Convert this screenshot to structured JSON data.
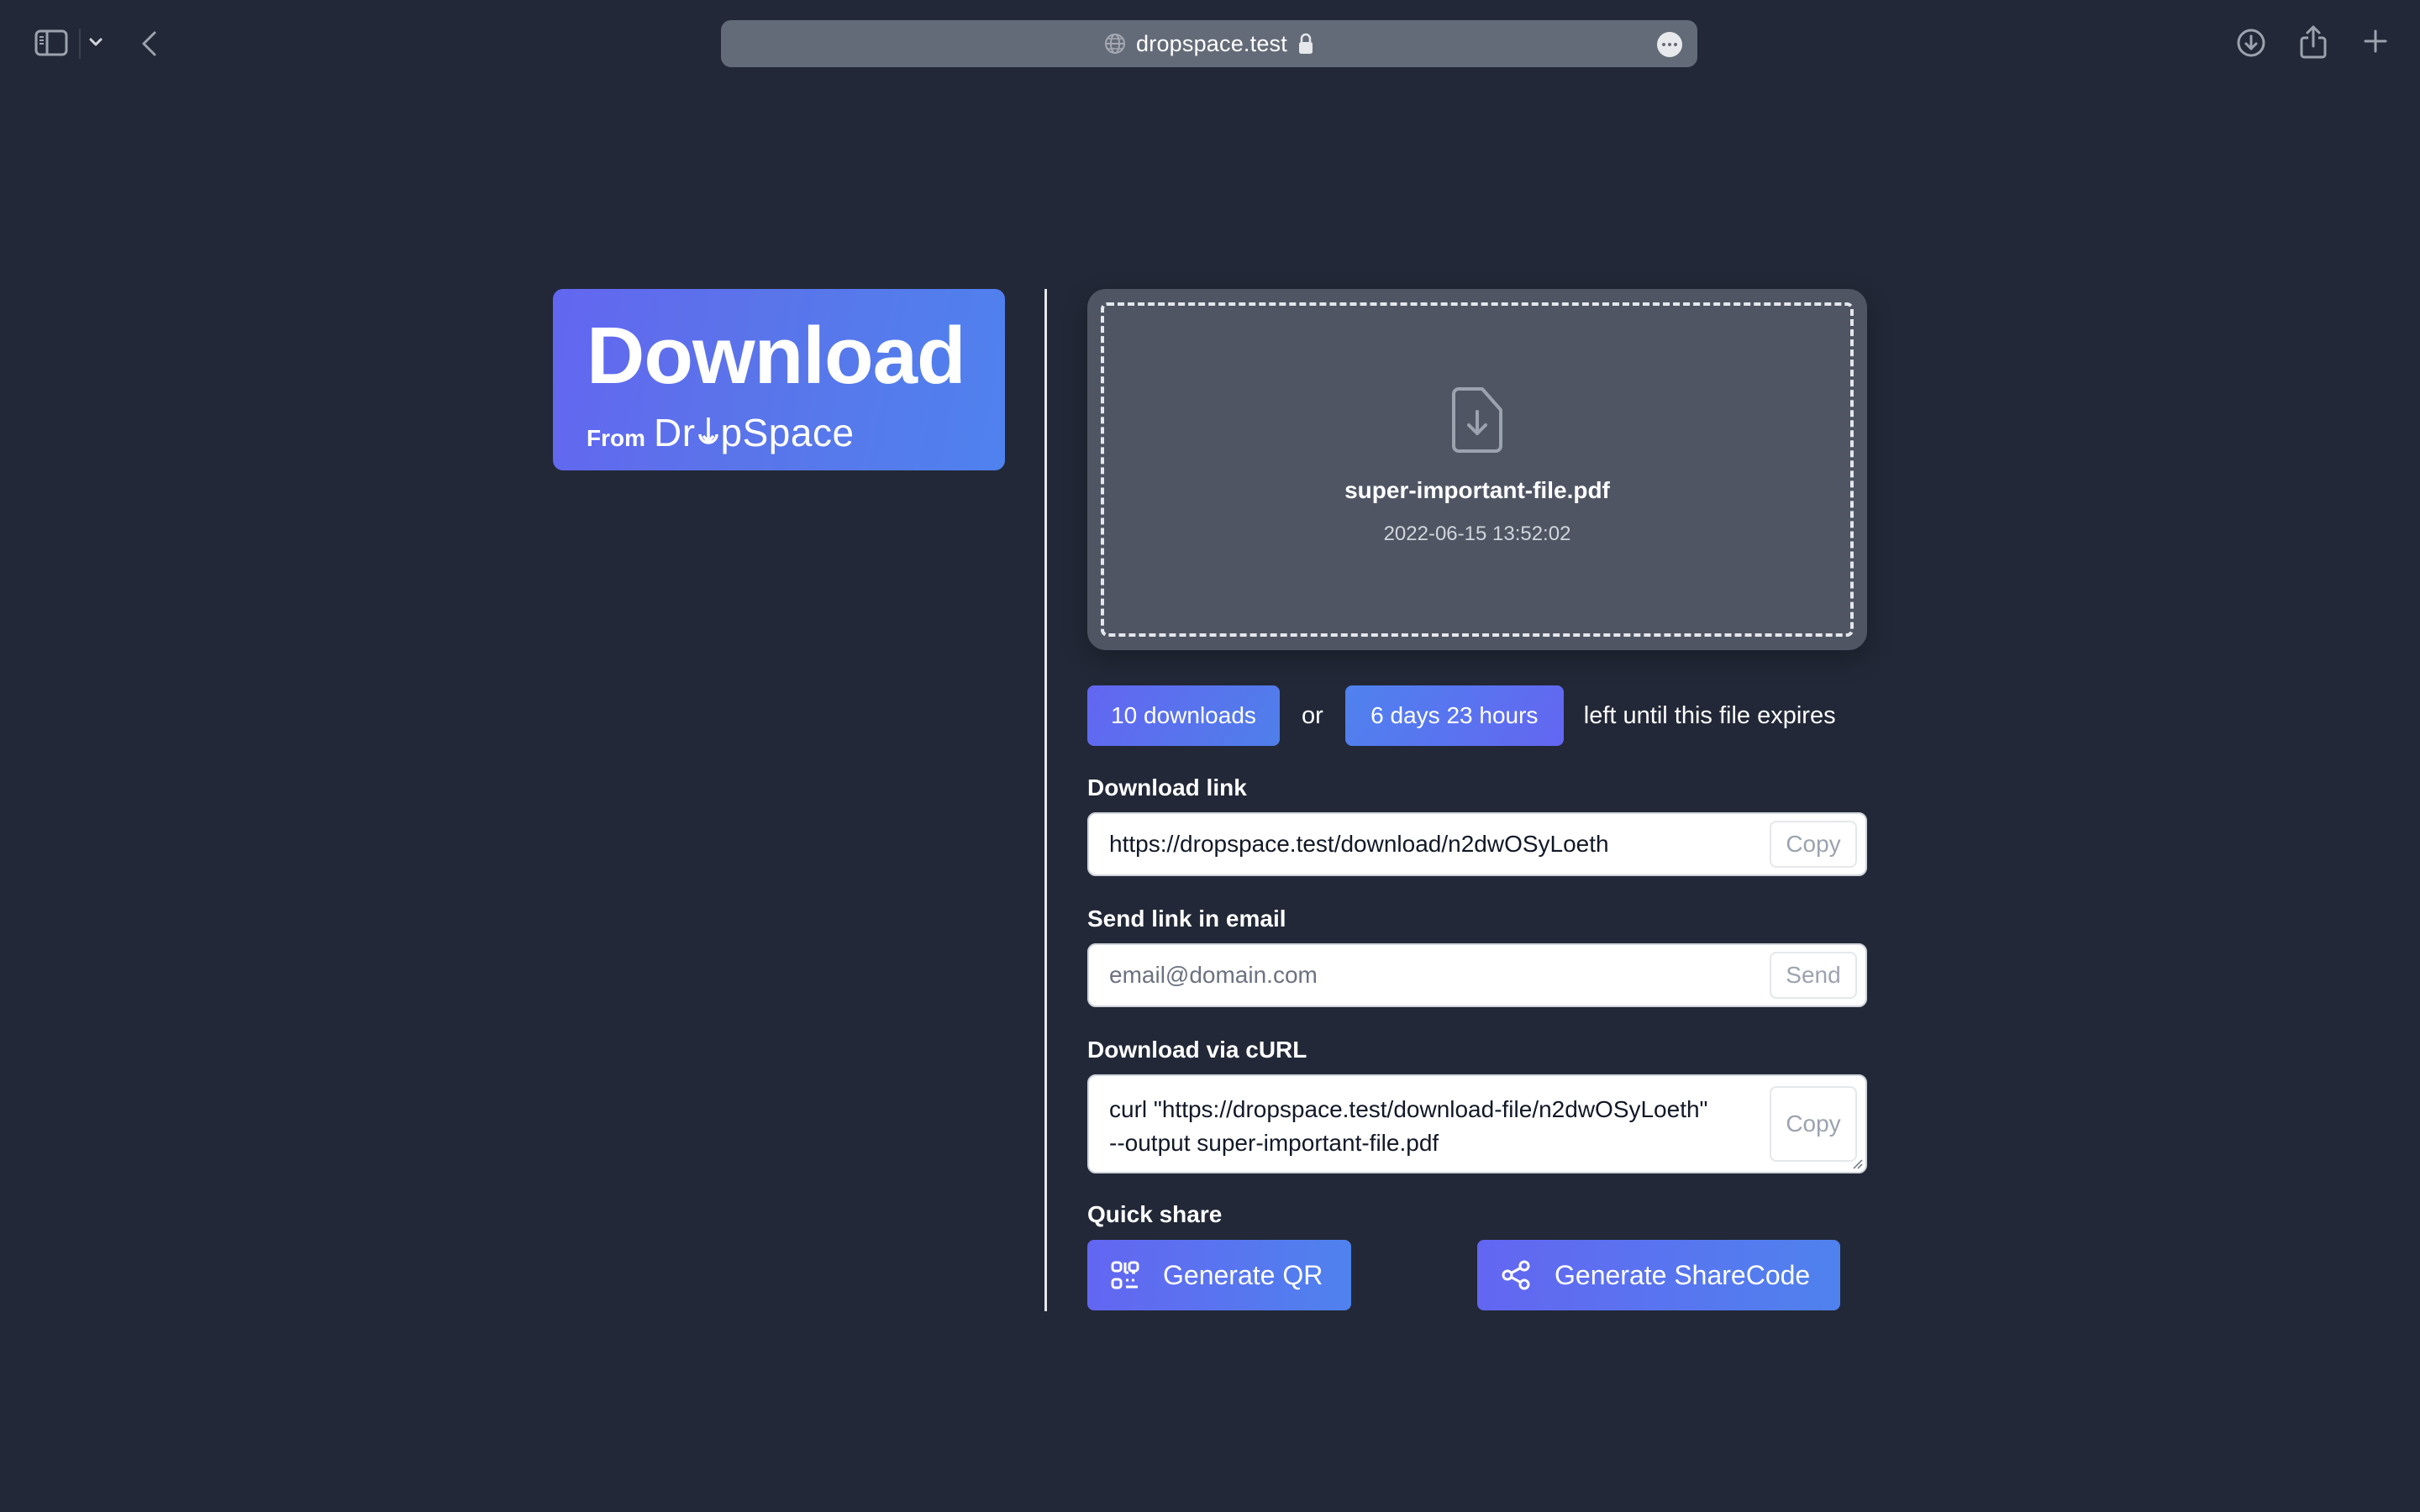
{
  "browser": {
    "address_bar": {
      "url": "dropspace.test",
      "secure": true
    },
    "left_icons": [
      "sidebar-icon",
      "chevron-down-icon",
      "back-icon"
    ],
    "right_icons": [
      "downloads-icon",
      "share-icon",
      "new-tab-icon"
    ]
  },
  "banner": {
    "title": "Download",
    "from_label": "From",
    "brand": "DrⓞpSpace",
    "brand_parts": {
      "before": "Dr",
      "after": "pSpace"
    }
  },
  "file": {
    "name": "super-important-file.pdf",
    "uploaded_at": "2022-06-15 13:52:02",
    "icon": "file-download-icon"
  },
  "expiry": {
    "downloads_badge": "10 downloads",
    "or_text": "or",
    "time_badge": "6 days 23 hours",
    "suffix": "left until this file expires"
  },
  "download_link": {
    "label": "Download link",
    "value": "https://dropspace.test/download/n2dwOSyLoeth",
    "button": "Copy"
  },
  "email": {
    "label": "Send link in email",
    "value": "",
    "placeholder": "email@domain.com",
    "button": "Send"
  },
  "curl": {
    "label": "Download via cURL",
    "value": "curl \"https://dropspace.test/download-file/n2dwOSyLoeth\"\n--output super-important-file.pdf",
    "button": "Copy"
  },
  "quick_share": {
    "label": "Quick share",
    "qr_button": "Generate QR",
    "sharecode_button": "Generate ShareCode"
  },
  "colors": {
    "background": "#222837",
    "accent_indigo": "#6366f1",
    "accent_blue": "#4f82ee",
    "card": "#4f5563",
    "address_bar": "#646b78"
  }
}
